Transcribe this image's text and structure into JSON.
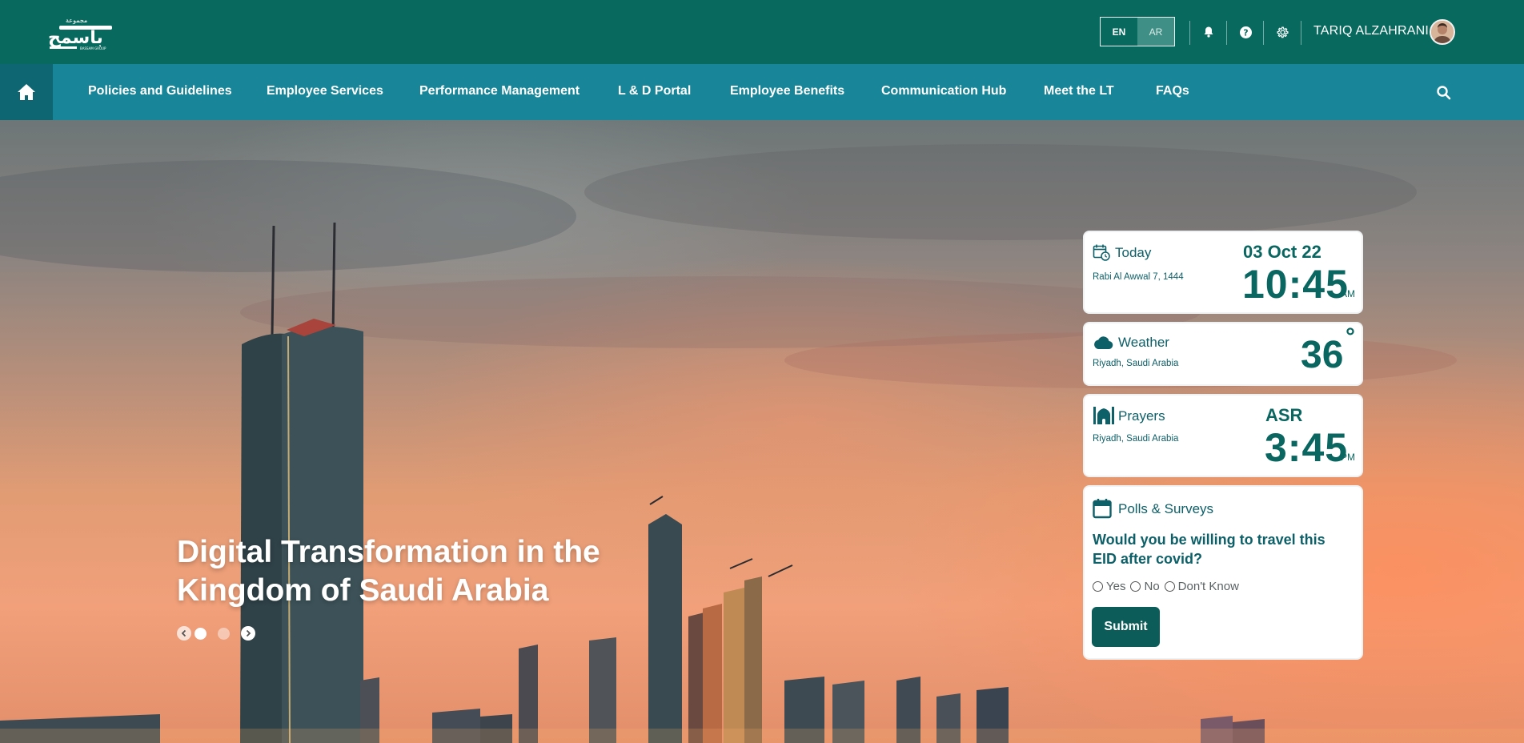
{
  "brand": {
    "logo_text": "باسمح",
    "logo_sub": "مجموعة",
    "logo_en": "BASSAM GROUP"
  },
  "topbar": {
    "lang_en": "EN",
    "lang_ar": "AR",
    "user_name": "TARIQ ALZAHRANI",
    "icons": [
      "bell-icon",
      "help-icon",
      "gear-icon"
    ]
  },
  "nav": {
    "items": [
      {
        "label": "Policies and Guidelines"
      },
      {
        "label": "Employee Services"
      },
      {
        "label": "Performance Management"
      },
      {
        "label": "L & D Portal"
      },
      {
        "label": "Employee Benefits"
      },
      {
        "label": "Communication Hub"
      },
      {
        "label": "Meet the LT"
      },
      {
        "label": "FAQs"
      }
    ]
  },
  "hero": {
    "title": "Digital Transformation in the Kingdom of Saudi Arabia",
    "slides_count": 2,
    "active_slide": 1
  },
  "widgets": {
    "today": {
      "title": "Today",
      "hijri": "Rabi Al Awwal 7, 1444",
      "date": "03 Oct 22",
      "time": "10:45",
      "ampm": "AM"
    },
    "weather": {
      "title": "Weather",
      "location": "Riyadh, Saudi Arabia",
      "temp": "36",
      "degree": "°"
    },
    "prayers": {
      "title": "Prayers",
      "location": "Riyadh, Saudi Arabia",
      "name": "ASR",
      "time": "3:45",
      "ampm": "PM"
    },
    "polls": {
      "title": "Polls & Surveys",
      "question": "Would you be willing to travel this EID after covid?",
      "options": [
        "Yes",
        "No",
        "Don't Know"
      ],
      "submit": "Submit"
    }
  },
  "colors": {
    "topbar": "#086a5e",
    "navbar": "#188698",
    "home": "#0e6672",
    "accent": "#0a6660"
  }
}
